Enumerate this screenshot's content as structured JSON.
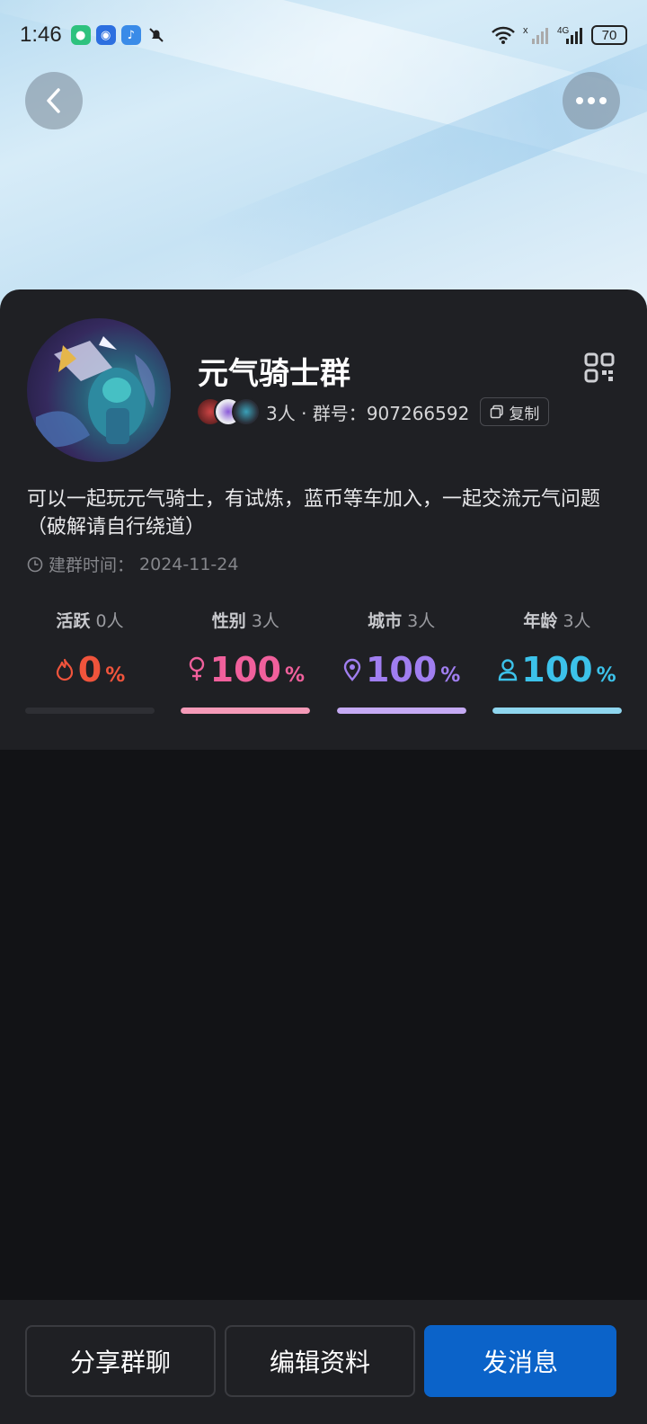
{
  "status_bar": {
    "time": "1:46",
    "battery": "70",
    "network": "4G"
  },
  "header": {
    "back_icon": "chevron-left-icon",
    "more_icon": "more-dots-icon"
  },
  "group": {
    "name": "元气骑士群",
    "member_count": "3人",
    "separator": "·",
    "id_label": "群号：",
    "id": "907266592",
    "copy_label": "复制",
    "description": "可以一起玩元气骑士，有试炼，蓝币等车加入，一起交流元气问题（破解请自行绕道）",
    "created_label": "建群时间：",
    "created_date": "2024-11-24"
  },
  "stats": [
    {
      "label": "活跃",
      "count": "0人",
      "value": "0",
      "unit": "%",
      "icon": "flame-icon",
      "color": "#f0543c",
      "fill": 0
    },
    {
      "label": "性别",
      "count": "3人",
      "value": "100",
      "unit": "%",
      "icon": "female-icon",
      "color": "#f0609c",
      "fill": 1
    },
    {
      "label": "城市",
      "count": "3人",
      "value": "100",
      "unit": "%",
      "icon": "location-pin-icon",
      "color": "#a07ef0",
      "fill": 1
    },
    {
      "label": "年龄",
      "count": "3人",
      "value": "100",
      "unit": "%",
      "icon": "person-icon",
      "color": "#3cc2ea",
      "fill": 1
    }
  ],
  "bar_colors": [
    "#2e2f34",
    "#f59ab8",
    "#c5aaf4",
    "#8fd6ef"
  ],
  "actions": {
    "share": "分享群聊",
    "edit": "编辑资料",
    "send": "发消息"
  },
  "colors": {
    "primary_button": "#0b63c9",
    "card_bg": "#1f2024"
  }
}
